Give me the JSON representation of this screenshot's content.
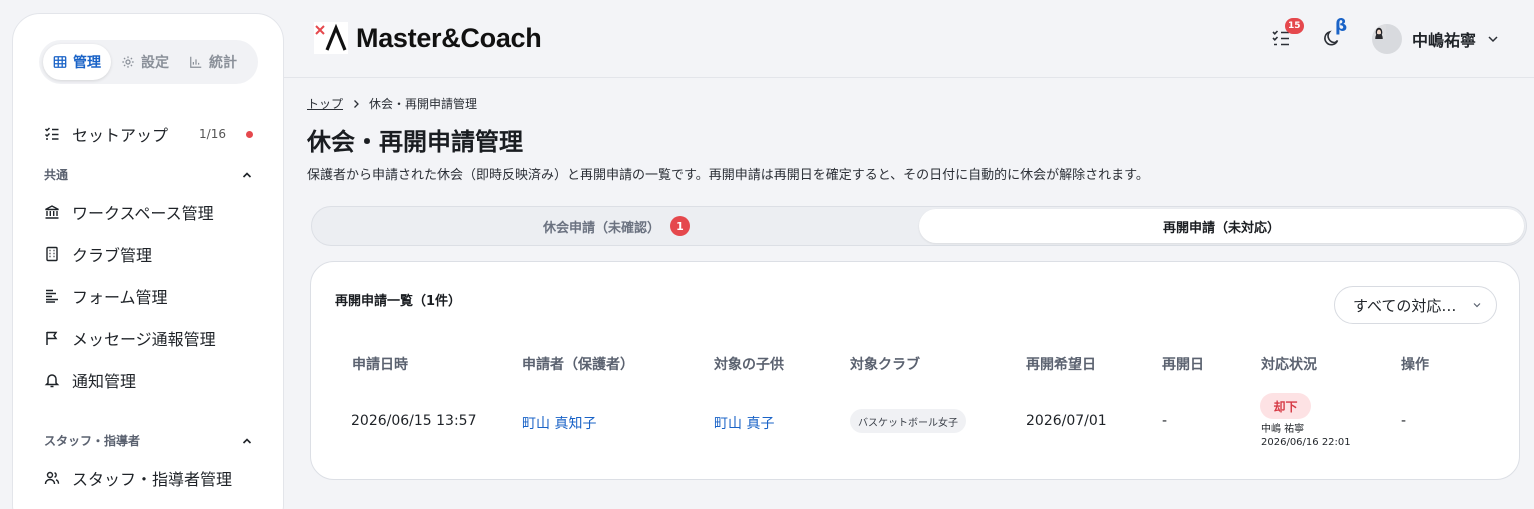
{
  "sidebar": {
    "segments": [
      {
        "label": "管理",
        "icon": "table-icon",
        "active": true
      },
      {
        "label": "設定",
        "icon": "gear-icon",
        "active": false
      },
      {
        "label": "統計",
        "icon": "chart-icon",
        "active": false
      }
    ],
    "setup": {
      "label": "セットアップ",
      "count": "1/16"
    },
    "sections": [
      {
        "title": "共通",
        "items": [
          "ワークスペース管理",
          "クラブ管理",
          "フォーム管理",
          "メッセージ通報管理",
          "通知管理"
        ]
      },
      {
        "title": "スタッフ・指導者",
        "items": [
          "スタッフ・指導者管理"
        ]
      }
    ]
  },
  "header": {
    "app_name": "Master&Coach",
    "task_badge": "15",
    "beta_label": "β",
    "user_name": "中嶋祐寧"
  },
  "breadcrumb": {
    "home": "トップ",
    "current": "休会・再開申請管理"
  },
  "page": {
    "title": "休会・再開申請管理",
    "description": "保護者から申請された休会（即時反映済み）と再開申請の一覧です。再開申請は再開日を確定すると、その日付に自動的に休会が解除されます。"
  },
  "tabs": [
    {
      "label": "休会申請（未確認）",
      "badge": "1",
      "active": false
    },
    {
      "label": "再開申請（未対応）",
      "badge": null,
      "active": true
    }
  ],
  "list": {
    "title": "再開申請一覧（1件）",
    "filter_value": "すべての対応…",
    "columns": [
      "申請日時",
      "申請者（保護者）",
      "対象の子供",
      "対象クラブ",
      "再開希望日",
      "再開日",
      "対応状況",
      "操作"
    ],
    "rows": [
      {
        "applied_at": "2026/06/15 13:57",
        "applicant": "町山 真知子",
        "child": "町山 真子",
        "club": "バスケットボール女子",
        "desired_date": "2026/07/01",
        "resume_date": "-",
        "status": "却下",
        "handled_by": "中嶋 祐寧",
        "handled_at": "2026/06/16 22:01",
        "action": "-"
      }
    ]
  },
  "colors": {
    "accent": "#1a63c7",
    "danger": "#e5484d",
    "status_bg": "#fde2e4"
  }
}
